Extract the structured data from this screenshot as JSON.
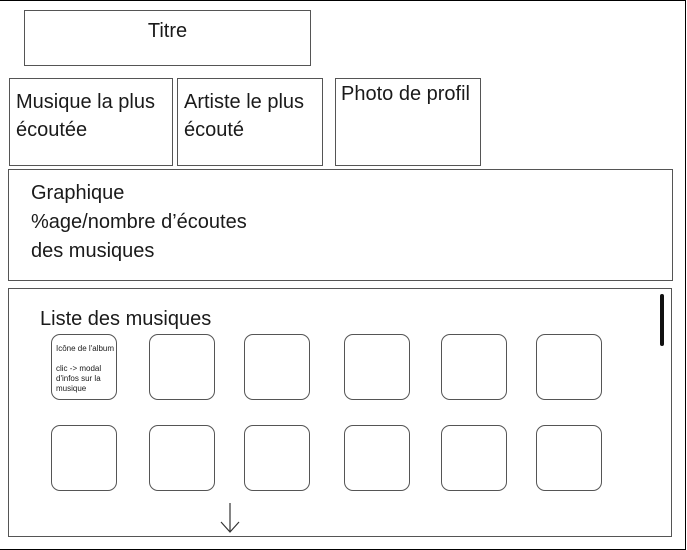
{
  "header": {
    "title": "Titre"
  },
  "stats": {
    "most_played_music": "Musique la plus\nécoutée",
    "most_played_artist": "Artiste le plus\nécouté",
    "profile_photo": "Photo de profil"
  },
  "chart": {
    "placeholder": "Graphique\n%age/nombre d’écoutes\ndes musiques"
  },
  "music_list": {
    "title": "Liste des musiques",
    "first_tile_note": "Icône de l'album\n\nclic -> modal\nd'infos sur la\nmusique",
    "icons": {
      "scroll_down": "arrow-down-icon"
    }
  }
}
